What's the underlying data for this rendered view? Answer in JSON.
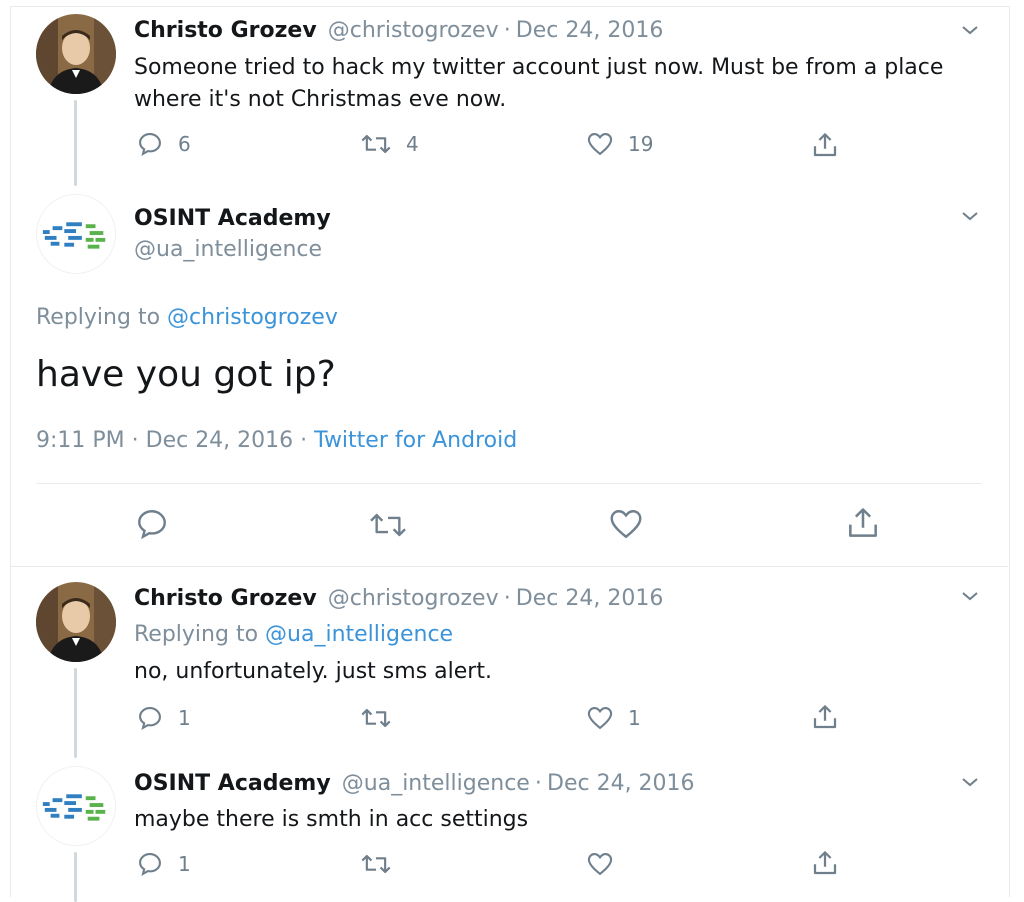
{
  "tweet1": {
    "display_name": "Christo Grozev",
    "handle": "@christogrozev",
    "date": "Dec 24, 2016",
    "text_line1": "Someone tried to hack my twitter account just now. Must be from a place",
    "text_line2": "where it's not Christmas eve now.",
    "replies": "6",
    "retweets": "4",
    "likes": "19"
  },
  "main_tweet": {
    "display_name": "OSINT Academy",
    "handle": "@ua_intelligence",
    "replying_prefix": "Replying to",
    "replying_handle": "@christogrozev",
    "text": "have you got ip?",
    "timestamp": "9:11 PM · Dec 24, 2016 · ",
    "source": "Twitter for Android"
  },
  "reply1": {
    "display_name": "Christo Grozev",
    "handle": "@christogrozev",
    "date": "Dec 24, 2016",
    "replying_prefix": "Replying to",
    "replying_handle": "@ua_intelligence",
    "text": "no, unfortunately. just sms alert.",
    "replies": "1",
    "likes": "1"
  },
  "reply2": {
    "display_name": "OSINT Academy",
    "handle": "@ua_intelligence",
    "date": "Dec 24, 2016",
    "text": "maybe there is smth in acc settings",
    "replies": "1"
  },
  "separator": "·",
  "colors": {
    "link": "#3b94d9",
    "muted": "#7e8e9b",
    "text": "#14171a",
    "logo_blue": "#2f7fc1",
    "logo_green": "#59b24b"
  },
  "icons": [
    "reply-icon",
    "retweet-icon",
    "like-icon",
    "share-icon",
    "chevron-down-icon"
  ]
}
